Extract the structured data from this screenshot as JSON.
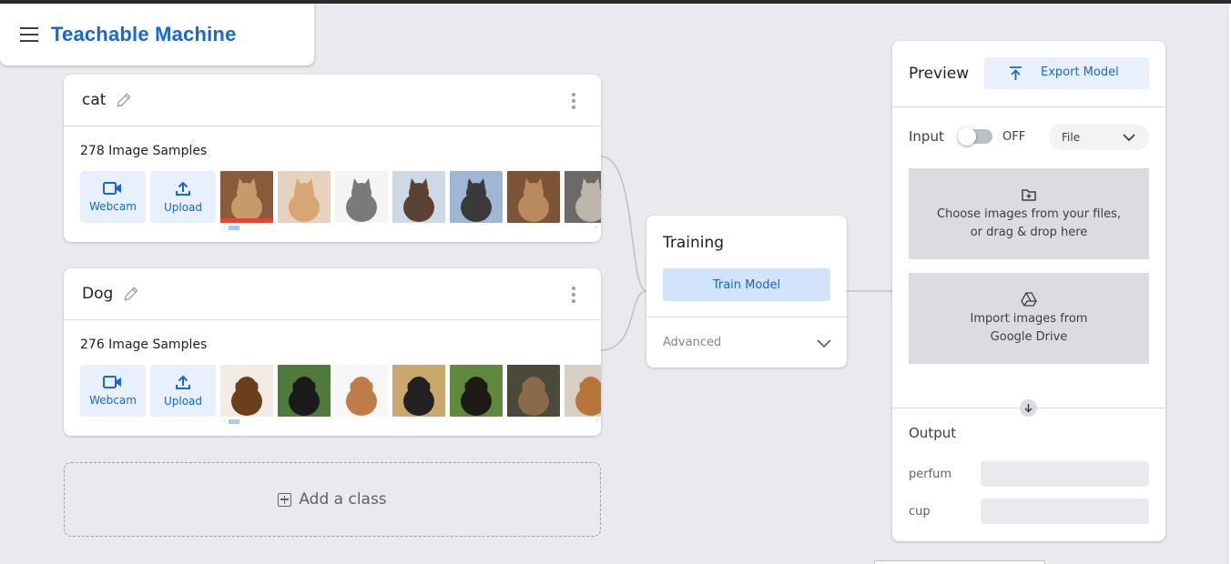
{
  "app": {
    "title": "Teachable Machine"
  },
  "classes": [
    {
      "name": "cat",
      "samples_label": "278 Image Samples",
      "webcam_label": "Webcam",
      "upload_label": "Upload",
      "thumbs": [
        {
          "subject": "cat",
          "bg": "#8a5a3c",
          "fg": "#c79a6a"
        },
        {
          "subject": "cat",
          "bg": "#e6d2bf",
          "fg": "#d8a574"
        },
        {
          "subject": "cat",
          "bg": "#f4f4f4",
          "fg": "#7a7a7a"
        },
        {
          "subject": "cat",
          "bg": "#cfd8e6",
          "fg": "#5b4334"
        },
        {
          "subject": "cat",
          "bg": "#9fb7d4",
          "fg": "#3a3a3a"
        },
        {
          "subject": "cat",
          "bg": "#7c5438",
          "fg": "#b98a5e"
        },
        {
          "subject": "cat",
          "bg": "#6a6a66",
          "fg": "#bdb6a8"
        }
      ]
    },
    {
      "name": "Dog",
      "samples_label": "276 Image Samples",
      "webcam_label": "Webcam",
      "upload_label": "Upload",
      "thumbs": [
        {
          "subject": "dog",
          "bg": "#f2ece4",
          "fg": "#6b3f1d"
        },
        {
          "subject": "dog",
          "bg": "#4f7a3c",
          "fg": "#1a1a1a"
        },
        {
          "subject": "dog",
          "bg": "#f6f6f6",
          "fg": "#c07c46"
        },
        {
          "subject": "dog",
          "bg": "#c9a86b",
          "fg": "#222222"
        },
        {
          "subject": "dog",
          "bg": "#5f8a3e",
          "fg": "#1e1a16"
        },
        {
          "subject": "dog",
          "bg": "#4b4a3a",
          "fg": "#8a6a48"
        },
        {
          "subject": "dog",
          "bg": "#d8cfc4",
          "fg": "#b7753a"
        }
      ]
    }
  ],
  "add_class_label": "Add a class",
  "training": {
    "title": "Training",
    "train_button": "Train Model",
    "advanced_label": "Advanced"
  },
  "preview": {
    "title": "Preview",
    "export_button": "Export Model",
    "input_label": "Input",
    "toggle_state": "OFF",
    "source_select": "File",
    "drop_files_line1": "Choose images from your files,",
    "drop_files_line2": "or drag & drop here",
    "drive_line1": "Import images from",
    "drive_line2": "Google Drive",
    "output_title": "Output",
    "outputs": [
      {
        "label": "perfum"
      },
      {
        "label": "cup"
      }
    ]
  },
  "colors": {
    "accent": "#1967d2",
    "accent_light": "#e8f0fe",
    "background": "#e8eaed"
  }
}
